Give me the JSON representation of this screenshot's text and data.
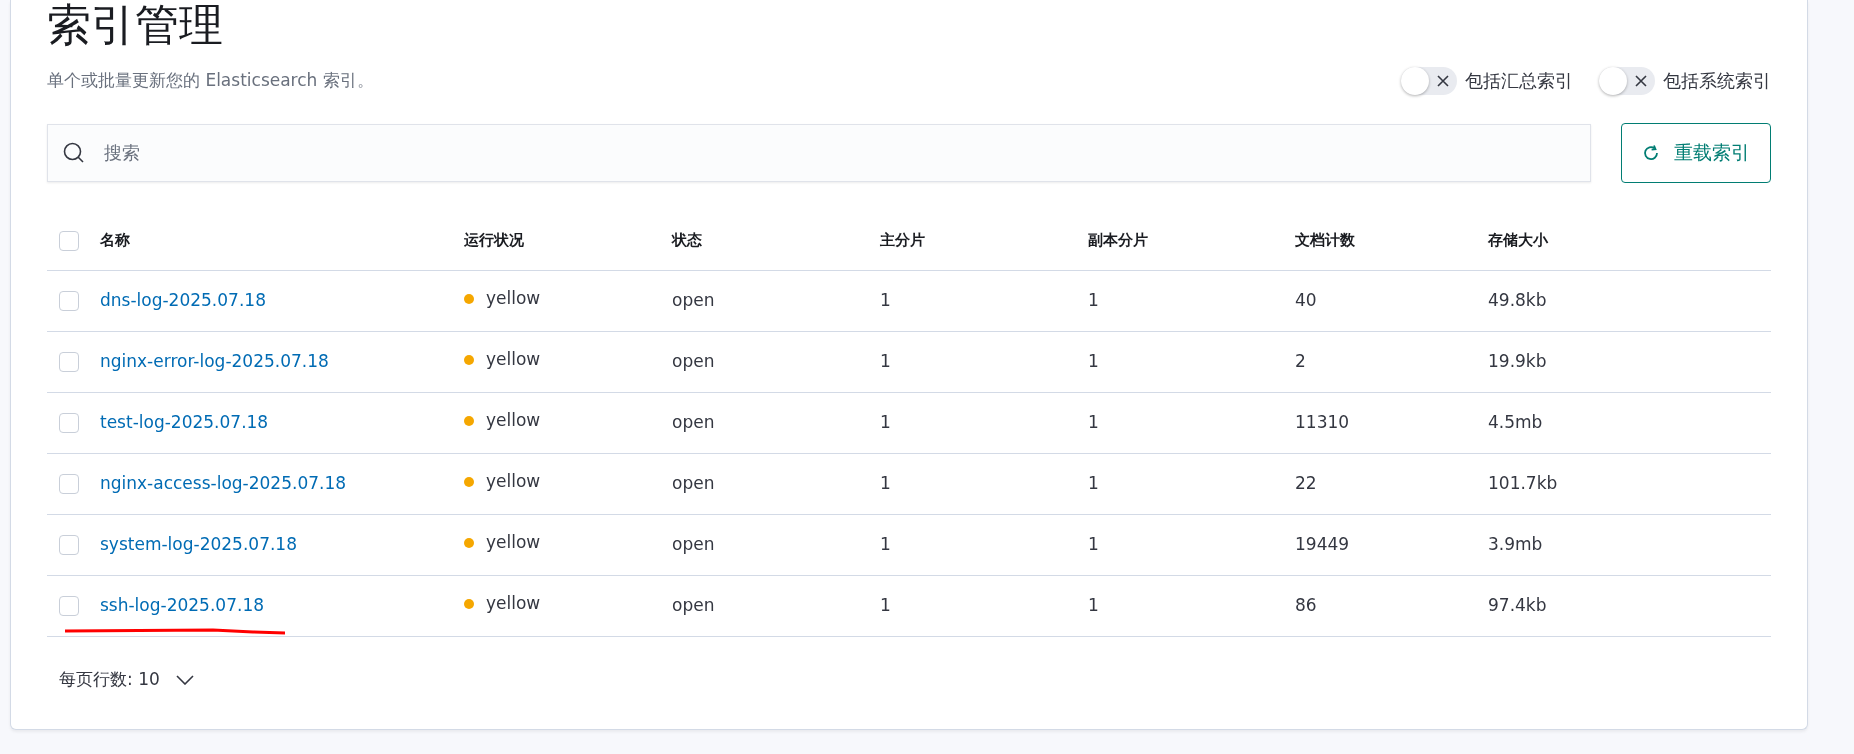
{
  "title": "索引管理",
  "subtitle": "单个或批量更新您的 Elasticsearch 索引。",
  "toggles": [
    {
      "label": "包括汇总索引",
      "on": false
    },
    {
      "label": "包括系统索引",
      "on": false
    }
  ],
  "search": {
    "placeholder": "搜索"
  },
  "reload_button": {
    "label": "重载索引"
  },
  "table": {
    "all_selected": false,
    "columns": [
      "名称",
      "运行状况",
      "状态",
      "主分片",
      "副本分片",
      "文档计数",
      "存储大小"
    ],
    "rows": [
      {
        "selected": false,
        "name": "dns-log-2025.07.18",
        "health": "yellow",
        "color": "#f5a700",
        "status": "open",
        "primary": "1",
        "replica": "1",
        "docs": "40",
        "size": "49.8kb"
      },
      {
        "selected": false,
        "name": "nginx-error-log-2025.07.18",
        "health": "yellow",
        "color": "#f5a700",
        "status": "open",
        "primary": "1",
        "replica": "1",
        "docs": "2",
        "size": "19.9kb"
      },
      {
        "selected": false,
        "name": "test-log-2025.07.18",
        "health": "yellow",
        "color": "#f5a700",
        "status": "open",
        "primary": "1",
        "replica": "1",
        "docs": "11310",
        "size": "4.5mb"
      },
      {
        "selected": false,
        "name": "nginx-access-log-2025.07.18",
        "health": "yellow",
        "color": "#f5a700",
        "status": "open",
        "primary": "1",
        "replica": "1",
        "docs": "22",
        "size": "101.7kb"
      },
      {
        "selected": false,
        "name": "system-log-2025.07.18",
        "health": "yellow",
        "color": "#f5a700",
        "status": "open",
        "primary": "1",
        "replica": "1",
        "docs": "19449",
        "size": "3.9mb"
      },
      {
        "selected": false,
        "name": "ssh-log-2025.07.18",
        "health": "yellow",
        "color": "#f5a700",
        "status": "open",
        "primary": "1",
        "replica": "1",
        "docs": "86",
        "size": "97.4kb"
      }
    ]
  },
  "pagination": {
    "label": "每页行数: 10"
  }
}
